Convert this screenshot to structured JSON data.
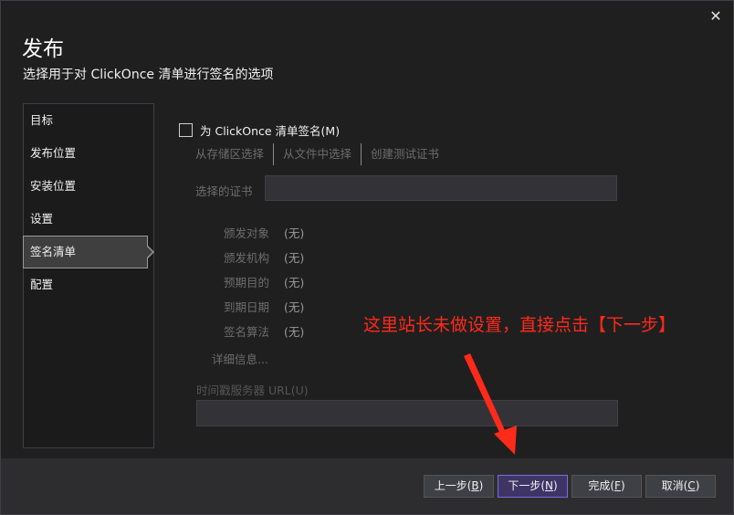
{
  "dialog": {
    "close_glyph": "✕",
    "title": "发布",
    "subtitle": "选择用于对 ClickOnce 清单进行签名的选项"
  },
  "nav": {
    "items": [
      {
        "label": "目标",
        "selected": false
      },
      {
        "label": "发布位置",
        "selected": false
      },
      {
        "label": "安装位置",
        "selected": false
      },
      {
        "label": "设置",
        "selected": false
      },
      {
        "label": "签名清单",
        "selected": true
      },
      {
        "label": "配置",
        "selected": false
      }
    ]
  },
  "signing": {
    "checkbox_label": "为 ClickOnce 清单签名(M)",
    "checked": false,
    "cert_sources": [
      "从存储区选择",
      "从文件中选择",
      "创建测试证书"
    ],
    "selected_cert_label": "选择的证书",
    "selected_cert_value": "",
    "info": [
      {
        "key": "颁发对象",
        "value": "(无)"
      },
      {
        "key": "颁发机构",
        "value": "(无)"
      },
      {
        "key": "预期目的",
        "value": "(无)"
      },
      {
        "key": "到期日期",
        "value": "(无)"
      },
      {
        "key": "签名算法",
        "value": "(无)"
      }
    ],
    "details_link": "详细信息...",
    "timestamp_label": "时间戳服务器 URL(U)",
    "timestamp_value": ""
  },
  "buttons": {
    "back": {
      "text": "上一步(",
      "acc": "B",
      "end": ")"
    },
    "next": {
      "text": "下一步(",
      "acc": "N",
      "end": ")"
    },
    "finish": {
      "text": "完成(",
      "acc": "F",
      "end": ")"
    },
    "cancel": {
      "text": "取消(",
      "acc": "C",
      "end": ")"
    }
  },
  "annotation": {
    "text": "这里站长未做设置，直接点击【下一步】",
    "color": "#ff2a1a"
  },
  "colors": {
    "accent": "#7b6cd9",
    "background": "#1f1f1f"
  }
}
